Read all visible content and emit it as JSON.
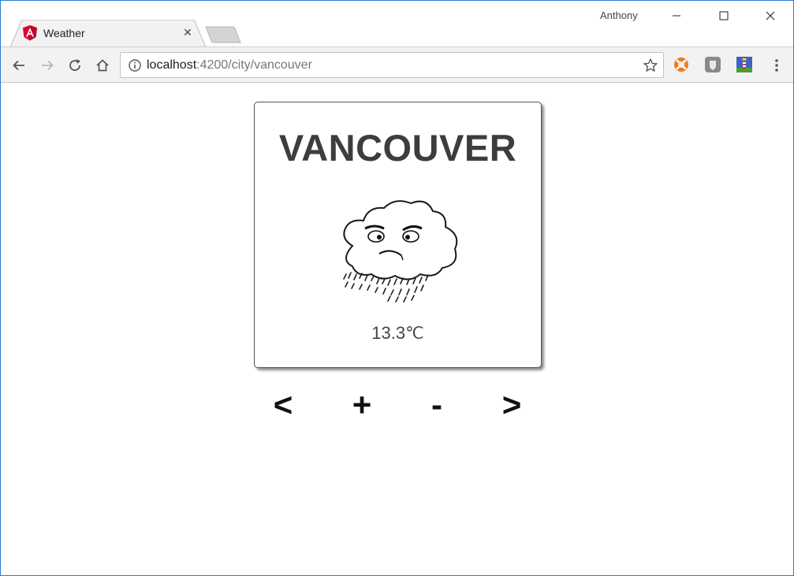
{
  "browser": {
    "profile_name": "Anthony",
    "tab": {
      "title": "Weather",
      "favicon": "angular-icon"
    },
    "address": {
      "host": "localhost",
      "path": ":4200/city/vancouver"
    },
    "window_controls": {
      "minimize": "minimize-icon",
      "maximize": "maximize-icon",
      "close": "close-icon"
    },
    "extensions": [
      "lifebuoy-extension-icon",
      "shield-extension-icon",
      "lighthouse-extension-icon"
    ]
  },
  "weather": {
    "city": "VANCOUVER",
    "condition_icon": "rain-cloud-icon",
    "temperature_value": "13.3",
    "temperature_unit": "℃"
  },
  "controls": {
    "prev_label": "<",
    "plus_label": "+",
    "minus_label": "-",
    "next_label": ">"
  },
  "colors": {
    "window_border": "#2b7bd4",
    "toolbar_bg": "#f2f2f2",
    "angular_red": "#dd0031",
    "city_text": "#3d3d3d"
  }
}
